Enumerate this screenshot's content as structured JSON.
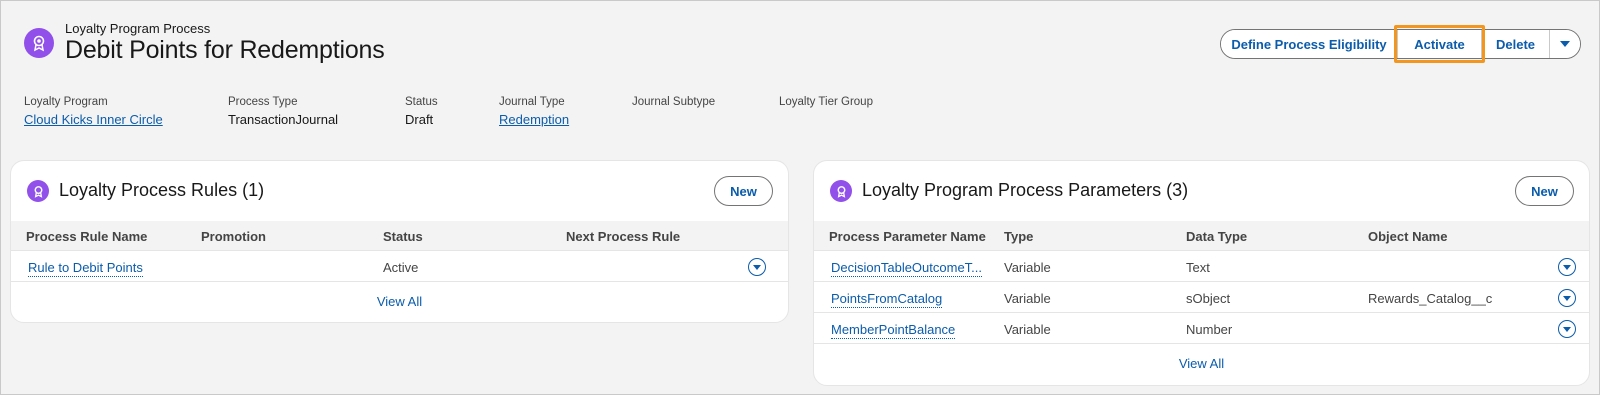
{
  "header": {
    "object_label": "Loyalty Program Process",
    "title": "Debit Points for Redemptions",
    "icon": "loyalty-badge-icon",
    "buttons": {
      "define_eligibility": "Define Process Eligibility",
      "activate": "Activate",
      "delete": "Delete"
    }
  },
  "highlights": [
    {
      "label": "Loyalty Program",
      "value": "Cloud Kicks Inner Circle"
    },
    {
      "label": "Process Type",
      "value": "TransactionJournal"
    },
    {
      "label": "Status",
      "value": "Draft"
    },
    {
      "label": "Journal Type",
      "value": "Redemption"
    },
    {
      "label": "Journal Subtype",
      "value": ""
    },
    {
      "label": "Loyalty Tier Group",
      "value": ""
    }
  ],
  "rules_card": {
    "title": "Loyalty Process Rules (1)",
    "new_label": "New",
    "columns": [
      "Process Rule Name",
      "Promotion",
      "Status",
      "Next Process Rule"
    ],
    "rows": [
      {
        "name": "Rule to Debit Points",
        "promotion": "",
        "status": "Active",
        "next": ""
      }
    ],
    "view_all": "View All"
  },
  "params_card": {
    "title": "Loyalty Program Process Parameters (3)",
    "new_label": "New",
    "columns": [
      "Process Parameter Name",
      "Type",
      "Data Type",
      "Object Name"
    ],
    "rows": [
      {
        "name": "DecisionTableOutcomeT...",
        "type": "Variable",
        "data_type": "Text",
        "object": ""
      },
      {
        "name": "PointsFromCatalog",
        "type": "Variable",
        "data_type": "sObject",
        "object": "Rewards_Catalog__c"
      },
      {
        "name": "MemberPointBalance",
        "type": "Variable",
        "data_type": "Number",
        "object": ""
      }
    ],
    "view_all": "View All"
  },
  "colors": {
    "brand_purple": "#9050e9",
    "link_blue": "#0b5cab",
    "focus_orange": "#f2961f"
  }
}
